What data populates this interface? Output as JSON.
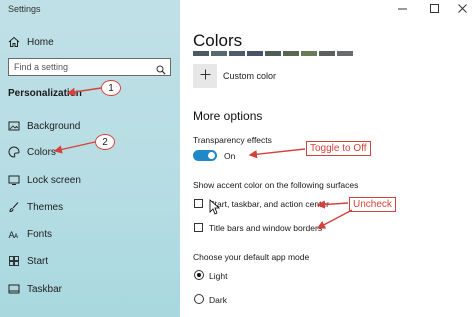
{
  "window": {
    "title": "Settings"
  },
  "sidebar": {
    "home_label": "Home",
    "search_placeholder": "Find a setting",
    "section_title": "Personalization",
    "items": [
      {
        "label": "Background"
      },
      {
        "label": "Colors"
      },
      {
        "label": "Lock screen"
      },
      {
        "label": "Themes"
      },
      {
        "label": "Fonts"
      },
      {
        "label": "Start"
      },
      {
        "label": "Taskbar"
      }
    ]
  },
  "main": {
    "heading": "Colors",
    "custom_color_label": "Custom color",
    "more_options_heading": "More options",
    "transparency": {
      "label": "Transparency effects",
      "state_label": "On",
      "value": true
    },
    "accent_surfaces": {
      "label": "Show accent color on the following surfaces",
      "options": [
        {
          "label": "Start, taskbar, and action center",
          "checked": false
        },
        {
          "label": "Title bars and window borders",
          "checked": false
        }
      ]
    },
    "app_mode": {
      "label": "Choose your default app mode",
      "options": [
        {
          "label": "Light",
          "selected": true
        },
        {
          "label": "Dark",
          "selected": false
        }
      ]
    }
  },
  "annotations": {
    "callout_1": "1",
    "callout_2": "2",
    "toggle_note": "Toggle to Off",
    "uncheck_note": "Uncheck"
  },
  "colors": {
    "accent": "#1e88c8",
    "annotation_red": "#d3433c",
    "swatches": [
      "#4a5a5e",
      "#566a72",
      "#505a6b",
      "#4b5268",
      "#525c57",
      "#5b6651",
      "#6b7a58",
      "#5a6060",
      "#6a6b6d"
    ]
  }
}
